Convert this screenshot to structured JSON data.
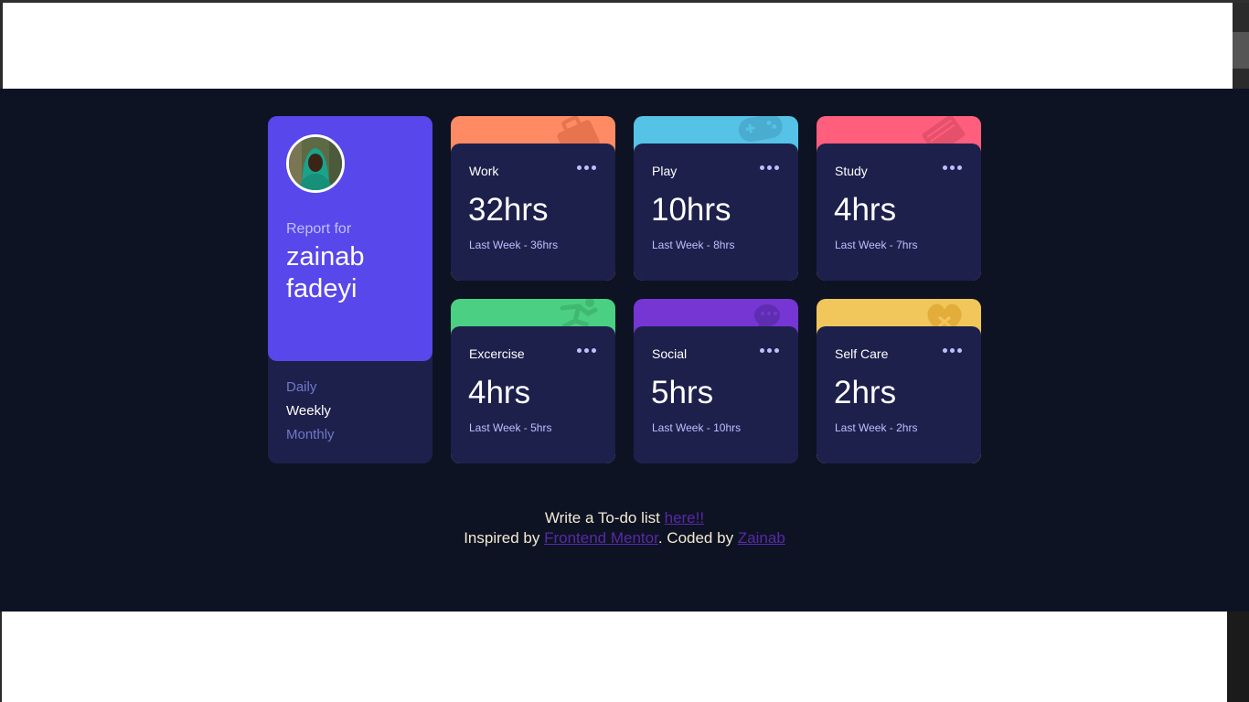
{
  "profile": {
    "report_label": "Report for",
    "name": "zainab fadeyi"
  },
  "periods": [
    {
      "label": "Daily",
      "active": false
    },
    {
      "label": "Weekly",
      "active": true
    },
    {
      "label": "Monthly",
      "active": false
    }
  ],
  "activities": [
    {
      "title": "Work",
      "hours": "32hrs",
      "previous": "Last Week - 36hrs",
      "color": "#ff8b64",
      "icon": "work-briefcase-icon"
    },
    {
      "title": "Play",
      "hours": "10hrs",
      "previous": "Last Week - 8hrs",
      "color": "#55c2e6",
      "icon": "play-gamepad-icon"
    },
    {
      "title": "Study",
      "hours": "4hrs",
      "previous": "Last Week - 7hrs",
      "color": "#ff5e7d",
      "icon": "study-book-icon"
    },
    {
      "title": "Excercise",
      "hours": "4hrs",
      "previous": "Last Week - 5hrs",
      "color": "#4bcf82",
      "icon": "exercise-runner-icon"
    },
    {
      "title": "Social",
      "hours": "5hrs",
      "previous": "Last Week - 10hrs",
      "color": "#7536d3",
      "icon": "social-chat-icon"
    },
    {
      "title": "Self Care",
      "hours": "2hrs",
      "previous": "Last Week - 2hrs",
      "color": "#f1c65b",
      "icon": "selfcare-heart-icon"
    }
  ],
  "footer": {
    "todo_text": "Write a To-do list ",
    "todo_link": "here!!",
    "inspired_text": "Inspired by ",
    "mentor_link": "Frontend Mentor",
    "coded_text": ". Coded by ",
    "author_link": "Zainab"
  }
}
